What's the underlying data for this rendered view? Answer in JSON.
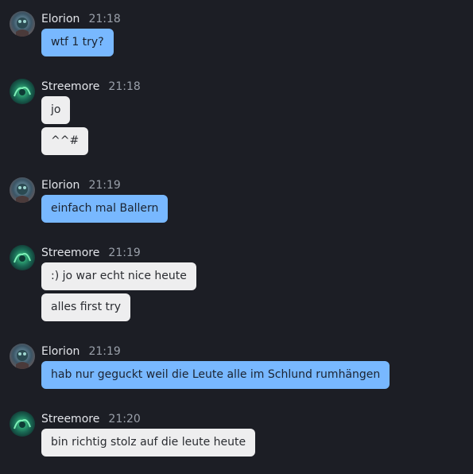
{
  "groups": [
    {
      "author": "Elorion",
      "time": "21:18",
      "avatar": "elorion-avatar",
      "style": "own",
      "messages": [
        "wtf 1 try?"
      ]
    },
    {
      "author": "Streemore",
      "time": "21:18",
      "avatar": "streemore-avatar",
      "style": "other",
      "messages": [
        "jo",
        "^^#"
      ]
    },
    {
      "author": "Elorion",
      "time": "21:19",
      "avatar": "elorion-avatar",
      "style": "own",
      "messages": [
        "einfach mal Ballern"
      ]
    },
    {
      "author": "Streemore",
      "time": "21:19",
      "avatar": "streemore-avatar",
      "style": "other",
      "messages": [
        ":) jo war echt nice heute",
        "alles first try"
      ]
    },
    {
      "author": "Elorion",
      "time": "21:19",
      "avatar": "elorion-avatar",
      "style": "own",
      "messages": [
        "hab nur geguckt weil die Leute alle im Schlund rumhängen"
      ]
    },
    {
      "author": "Streemore",
      "time": "21:20",
      "avatar": "streemore-avatar",
      "style": "other",
      "messages": [
        "bin richtig stolz auf die leute heute"
      ]
    }
  ],
  "colors": {
    "background": "#1c1e25",
    "own_bubble": "#78b8ff",
    "other_bubble": "#eeeeef"
  }
}
